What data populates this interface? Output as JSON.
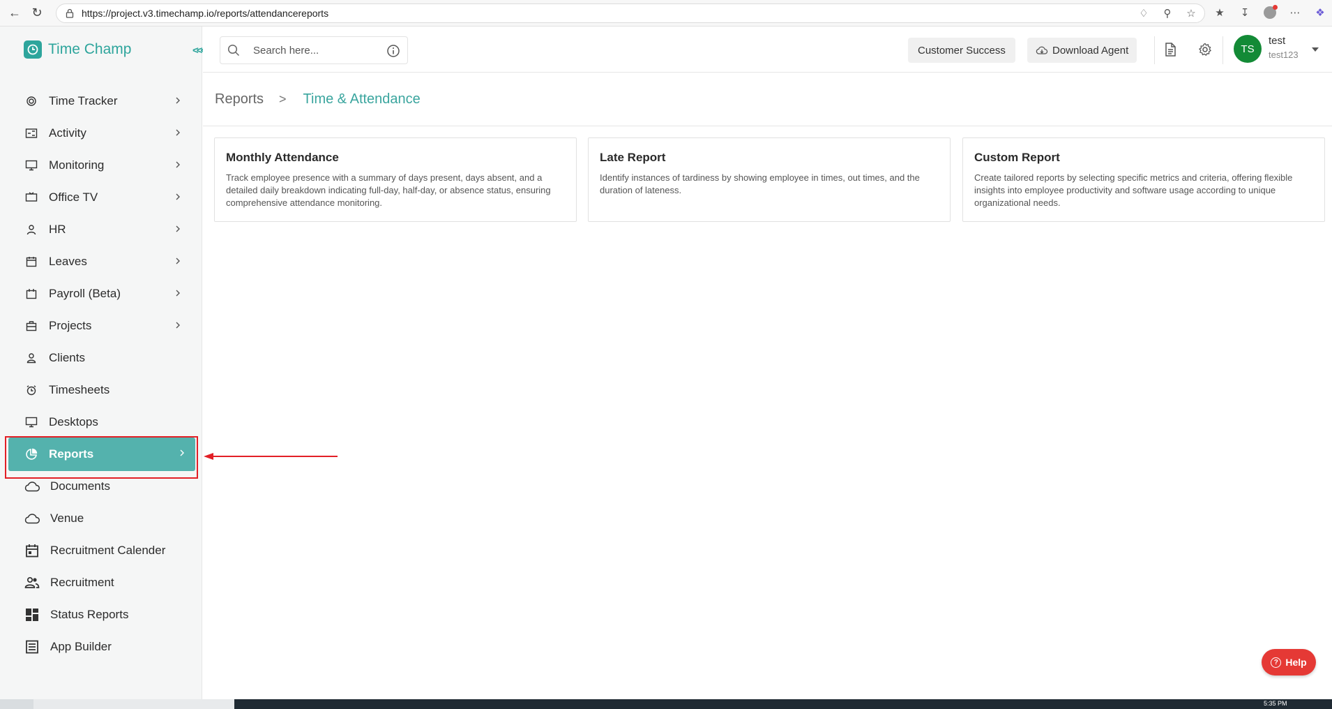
{
  "browser": {
    "url": "https://project.v3.timechamp.io/reports/attendancereports"
  },
  "app": {
    "logo_text": "Time Champ"
  },
  "sidebar": {
    "items": [
      {
        "label": "Time Tracker",
        "icon": "time-tracker-icon",
        "has_chevron": true
      },
      {
        "label": "Activity",
        "icon": "activity-icon",
        "has_chevron": true
      },
      {
        "label": "Monitoring",
        "icon": "monitor-icon",
        "has_chevron": true
      },
      {
        "label": "Office TV",
        "icon": "tv-icon",
        "has_chevron": true
      },
      {
        "label": "HR",
        "icon": "person-icon",
        "has_chevron": true
      },
      {
        "label": "Leaves",
        "icon": "calendar-icon",
        "has_chevron": true
      },
      {
        "label": "Payroll (Beta)",
        "icon": "payroll-icon",
        "has_chevron": true
      },
      {
        "label": "Projects",
        "icon": "briefcase-icon",
        "has_chevron": true
      },
      {
        "label": "Clients",
        "icon": "client-icon",
        "has_chevron": false
      },
      {
        "label": "Timesheets",
        "icon": "alarm-clock-icon",
        "has_chevron": false
      },
      {
        "label": "Desktops",
        "icon": "desktop-icon",
        "has_chevron": false
      },
      {
        "label": "Reports",
        "icon": "pie-chart-icon",
        "has_chevron": true,
        "active": true
      },
      {
        "label": "Documents",
        "icon": "cloud-icon",
        "has_chevron": false
      },
      {
        "label": "Venue",
        "icon": "cloud-icon",
        "has_chevron": false
      },
      {
        "label": "Recruitment Calender",
        "icon": "event-calendar-icon",
        "has_chevron": false
      },
      {
        "label": "Recruitment",
        "icon": "people-icon",
        "has_chevron": false
      },
      {
        "label": "Status Reports",
        "icon": "dashboard-icon",
        "has_chevron": false
      },
      {
        "label": "App Builder",
        "icon": "list-icon",
        "has_chevron": false
      }
    ]
  },
  "header": {
    "search_placeholder": "Search here...",
    "customer_success_label": "Customer Success",
    "download_agent_label": "Download Agent",
    "avatar_initials": "TS",
    "user_name": "test",
    "user_id": "test123"
  },
  "breadcrumb": {
    "root": "Reports",
    "separator": ">",
    "current": "Time & Attendance"
  },
  "cards": [
    {
      "title": "Monthly Attendance",
      "description": "Track employee presence with a summary of days present, days absent, and a detailed daily breakdown indicating full-day, half-day, or absence status, ensuring comprehensive attendance monitoring."
    },
    {
      "title": "Late Report",
      "description": "Identify instances of tardiness by showing employee in times, out times, and the duration of lateness."
    },
    {
      "title": "Custom Report",
      "description": "Create tailored reports by selecting specific metrics and criteria, offering flexible insights into employee productivity and software usage according to unique organizational needs."
    }
  ],
  "help": {
    "label": "Help"
  },
  "taskbar": {
    "time": "5:35 PM"
  },
  "colors": {
    "brand": "#2ea59c",
    "active_item": "#54b2ad",
    "annotation_red": "#e21f26",
    "help_red": "#e53935",
    "avatar_green": "#138a36"
  }
}
